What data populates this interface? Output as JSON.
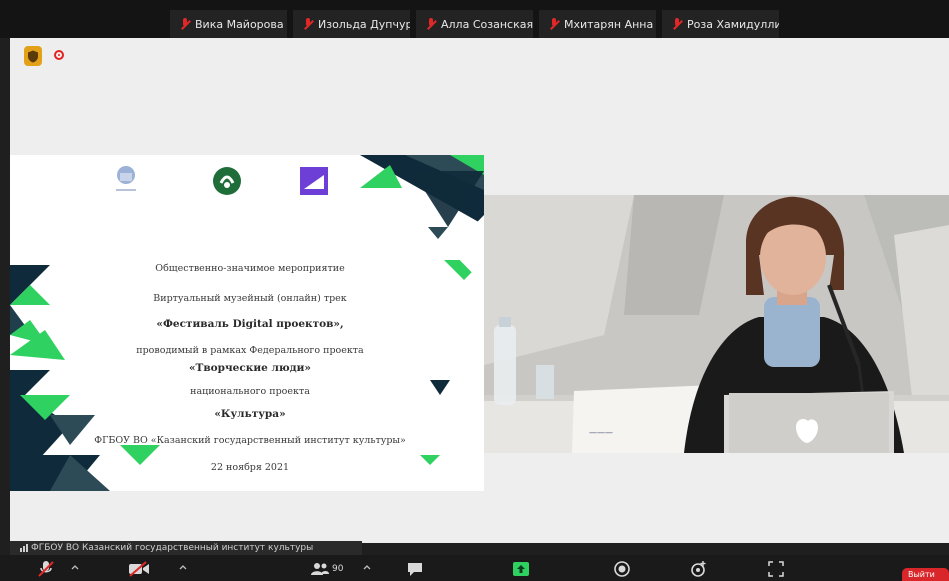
{
  "participants": [
    {
      "name": "Вика Майорова"
    },
    {
      "name": "Изольда Дупчур"
    },
    {
      "name": "Алла Созанская"
    },
    {
      "name": "Мхитарян Анна"
    },
    {
      "name": "Роза Хамидуллина"
    }
  ],
  "slide": {
    "line1": "Общественно-значимое мероприятие",
    "line2": "Виртуальный музейный (онлайн) трек",
    "line3": "«Фестиваль Digital проектов»,",
    "line4": "проводимый в рамках Федерального проекта",
    "line5": "«Творческие люди»",
    "line6": "национального проекта",
    "line7": "«Культура»",
    "line8": "ФГБОУ ВО «Казанский государственный институт культуры»",
    "date": "22 ноября 2021"
  },
  "active_speaker": {
    "name": "ФГБОУ ВО Казанский государственный институт культуры"
  },
  "toolbar": {
    "participants_count": "90",
    "end_label": "Выйти"
  },
  "colors": {
    "accent_green": "#2fd160",
    "dark_navy": "#0f2a3a",
    "mute_red": "#e02828",
    "end_red": "#d9262a"
  }
}
